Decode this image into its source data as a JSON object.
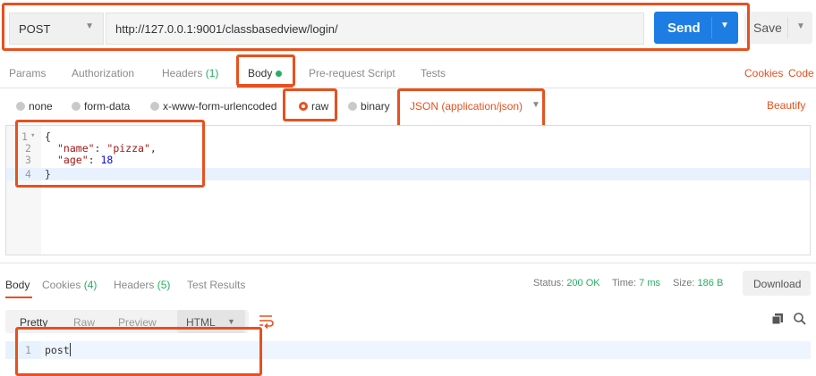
{
  "request": {
    "method": "POST",
    "url": "http://127.0.0.1:9001/classbasedview/login/",
    "send_label": "Send",
    "save_label": "Save"
  },
  "tabs": [
    {
      "label": "Params"
    },
    {
      "label": "Authorization"
    },
    {
      "label": "Headers",
      "count": "(1)"
    },
    {
      "label": "Body"
    },
    {
      "label": "Pre-request Script"
    },
    {
      "label": "Tests"
    }
  ],
  "links": {
    "cookies": "Cookies",
    "code": "Code",
    "beautify": "Beautify"
  },
  "body_types": [
    {
      "label": "none"
    },
    {
      "label": "form-data"
    },
    {
      "label": "x-www-form-urlencoded"
    },
    {
      "label": "raw",
      "selected": true
    },
    {
      "label": "binary"
    }
  ],
  "content_type": "JSON (application/json)",
  "editor": {
    "line_numbers": [
      "1",
      "2",
      "3",
      "4"
    ],
    "lines": [
      "{",
      "\"name\": \"pizza\",",
      "\"age\": 18",
      "}"
    ],
    "name_key": "\"name\"",
    "name_value": "\"pizza\"",
    "age_key": "\"age\"",
    "age_value": "18"
  },
  "response": {
    "tabs": [
      {
        "label": "Body"
      },
      {
        "label": "Cookies",
        "count": "(4)"
      },
      {
        "label": "Headers",
        "count": "(5)"
      },
      {
        "label": "Test Results"
      }
    ],
    "status_label": "Status:",
    "status_value": "200 OK",
    "time_label": "Time:",
    "time_value": "7 ms",
    "size_label": "Size:",
    "size_value": "186 B",
    "download_label": "Download",
    "views": [
      "Pretty",
      "Raw",
      "Preview"
    ],
    "format": "HTML",
    "line_number": "1",
    "content": "post"
  },
  "colors": {
    "accent": "#e8501e",
    "send": "#1d7de2",
    "success": "#27ae60"
  }
}
